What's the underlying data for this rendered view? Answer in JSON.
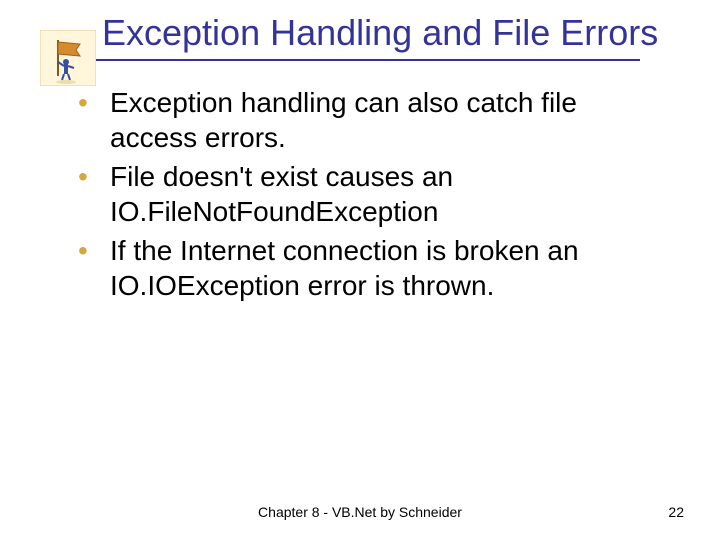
{
  "title": "Exception Handling and File Errors",
  "bullets": [
    "Exception handling can also catch file access errors.",
    "File doesn't exist causes an IO.FileNotFoundException",
    "If the Internet connection is broken an IO.IOException error is thrown."
  ],
  "footer": {
    "center": "Chapter 8 - VB.Net by Schneider",
    "page": "22"
  },
  "icon": {
    "name": "flag-person-icon"
  },
  "colors": {
    "title": "#33339a",
    "rule": "#33339a",
    "bullet": "#d4a83a"
  }
}
